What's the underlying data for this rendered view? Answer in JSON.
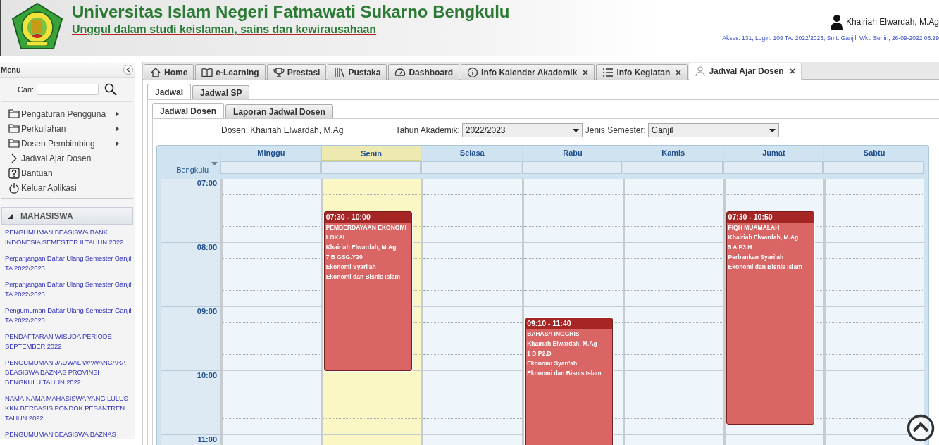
{
  "header": {
    "title": "Universitas Islam Negeri Fatmawati Sukarno Bengkulu",
    "tagline": "Unggul dalam studi keislaman, sains dan kewirausahaan",
    "user": "Khairiah Elwardah, M.Ag",
    "session": "Akses: 131, Login: 109 TA: 2022/2023, Smt: Ganjil, Wkt: Senin, 26-09-2022 08:29"
  },
  "sidebar": {
    "title": "Menu",
    "search_label": "Cari:",
    "items": [
      {
        "label": "Pengaturan Pengguna",
        "kind": "folder",
        "has_submenu": true
      },
      {
        "label": "Perkuliahan",
        "kind": "folder",
        "has_submenu": true
      },
      {
        "label": "Dosen Pembimbing",
        "kind": "folder",
        "has_submenu": true
      },
      {
        "label": "Jadwal Ajar Dosen",
        "kind": "link",
        "has_submenu": false
      },
      {
        "label": "Bantuan",
        "kind": "help",
        "has_submenu": false
      },
      {
        "label": "Keluar Aplikasi",
        "kind": "power",
        "has_submenu": false
      }
    ],
    "panel": {
      "title": "MAHASISWA",
      "expanded": true,
      "links": [
        "PENGUMUMAN BEASISWA BANK INDONESIA SEMESTER II TAHUN 2022",
        "Perpanjangan Daftar Ulang Semester Ganjil TA 2022/2023",
        "Perpanjangan Daftar Ulang Semester Ganjil TA 2022/2023",
        "Pengumuman Daftar Ulang Semester Ganjil TA 2022/2023",
        "PENDAFTARAN WISUDA PERIODE SEPTEMBER 2022",
        "PENGUMUMAN JADWAL WAWANCARA BEASISWA BAZNAS PROVINSI BENGKULU TAHUN 2022",
        "NAMA-NAMA MAHASISWA YANG LULUS KKN BERBASIS PONDOK PESANTREN TAHUN 2022",
        "PENGUMUMAN BEASISWA BAZNAS"
      ]
    }
  },
  "tabs": [
    {
      "label": "Home",
      "kind": "home",
      "closable": false,
      "selected": false
    },
    {
      "label": "e-Learning",
      "kind": "book",
      "closable": false,
      "selected": false
    },
    {
      "label": "Prestasi",
      "kind": "trophy",
      "closable": false,
      "selected": false
    },
    {
      "label": "Pustaka",
      "kind": "library",
      "closable": false,
      "selected": false
    },
    {
      "label": "Dashboard",
      "kind": "gauge",
      "closable": false,
      "selected": false
    },
    {
      "label": "Info Kalender Akademik",
      "kind": "info",
      "closable": true,
      "selected": false
    },
    {
      "label": "Info Kegiatan",
      "kind": "list",
      "closable": true,
      "selected": false
    },
    {
      "label": "Jadwal Ajar Dosen",
      "kind": "person",
      "closable": true,
      "selected": true
    }
  ],
  "subtabs": [
    {
      "label": "Jadwal",
      "selected": true
    },
    {
      "label": "Jadwal SP",
      "selected": false
    }
  ],
  "view_tabs": [
    {
      "label": "Jadwal Dosen",
      "selected": true
    },
    {
      "label": "Laporan Jadwal Dosen",
      "selected": false
    }
  ],
  "filters": {
    "lecturer": "Dosen: Khairiah Elwardah, M.Ag",
    "year_label": "Tahun Akademik:",
    "year": "2022/2023",
    "semester_label": "Jenis Semester:",
    "semester": "Ganjil"
  },
  "calendar": {
    "timezone": "Bengkulu",
    "hours": [
      "07:00",
      "08:00",
      "09:00",
      "10:00",
      "11:00"
    ],
    "days": [
      {
        "name": "Minggu",
        "selected": false
      },
      {
        "name": "Senin",
        "selected": true,
        "events": [
          {
            "time": "07:30 - 10:00",
            "title": "PEMBERDAYAAN EKONOMI LOKAL",
            "lecturer": "Khairiah Elwardah, M.Ag",
            "class": "7 B GSG.Y20",
            "program": "Ekonomi Syari'ah",
            "faculty": "Ekonomi dan Bisnis Islam"
          }
        ]
      },
      {
        "name": "Selasa",
        "selected": false
      },
      {
        "name": "Rabu",
        "selected": false,
        "events": [
          {
            "time": "09:10 - 11:40",
            "title": "BAHASA INGGRIS",
            "lecturer": "Khairiah Elwardah, M.Ag",
            "class": "1 D P2.D",
            "program": "Ekonomi Syari'ah",
            "faculty": "Ekonomi dan Bisnis Islam"
          }
        ]
      },
      {
        "name": "Kamis",
        "selected": false
      },
      {
        "name": "Jumat",
        "selected": false,
        "events": [
          {
            "time": "07:30 - 10:50",
            "title": "FIQH MUAMALAH",
            "lecturer": "Khairiah Elwardah, M.Ag",
            "class": "5 A P3.H",
            "program": "Perbankan Syari'ah",
            "faculty": "Ekonomi dan Bisnis Islam"
          }
        ]
      },
      {
        "name": "Sabtu",
        "selected": false
      }
    ]
  }
}
